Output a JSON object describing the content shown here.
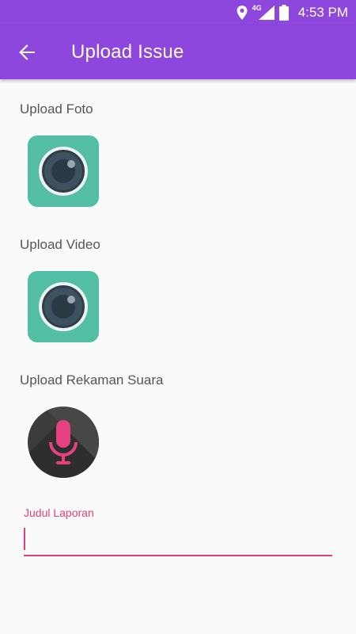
{
  "status_bar": {
    "time": "4:53 PM",
    "network": "4G",
    "icons": [
      "location-icon",
      "signal-icon",
      "battery-icon"
    ]
  },
  "app_bar": {
    "title": "Upload Issue",
    "back_icon": "arrow-left-icon",
    "color": "#8e47dc"
  },
  "sections": {
    "photo_label": "Upload Foto",
    "video_label": "Upload Video",
    "audio_label": "Upload Rekaman Suara"
  },
  "buttons": {
    "photo_icon": "camera-icon",
    "video_icon": "camera-icon",
    "audio_icon": "microphone-icon",
    "camera_color": "#52bfa4",
    "mic_color": "#e8417f"
  },
  "form": {
    "title_label": "Judul Laporan",
    "title_value": "",
    "accent_color": "#e0407e"
  }
}
